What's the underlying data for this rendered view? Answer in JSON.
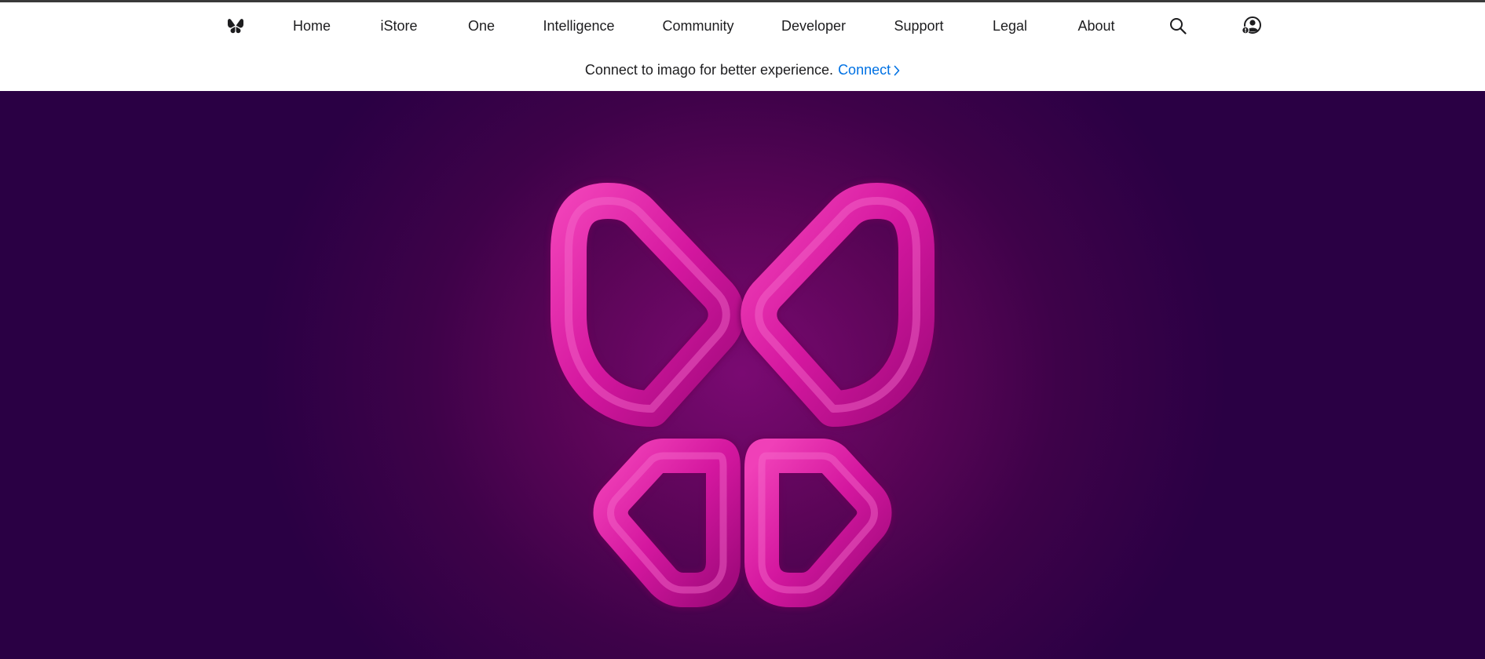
{
  "nav": {
    "items": [
      {
        "label": "Home"
      },
      {
        "label": "iStore"
      },
      {
        "label": "One"
      },
      {
        "label": "Intelligence"
      },
      {
        "label": "Community"
      },
      {
        "label": "Developer"
      },
      {
        "label": "Support"
      },
      {
        "label": "Legal"
      },
      {
        "label": "About"
      }
    ],
    "icons": {
      "logo": "butterfly-logo-icon",
      "search": "search-icon",
      "account": "account-icon"
    }
  },
  "banner": {
    "message": "Connect to imago for better experience.",
    "link_label": "Connect"
  },
  "colors": {
    "link": "#0071e3",
    "hero_dark": "#2a0044",
    "hero_glow": "#7a0a72",
    "logo_pink": "#d4179f"
  }
}
